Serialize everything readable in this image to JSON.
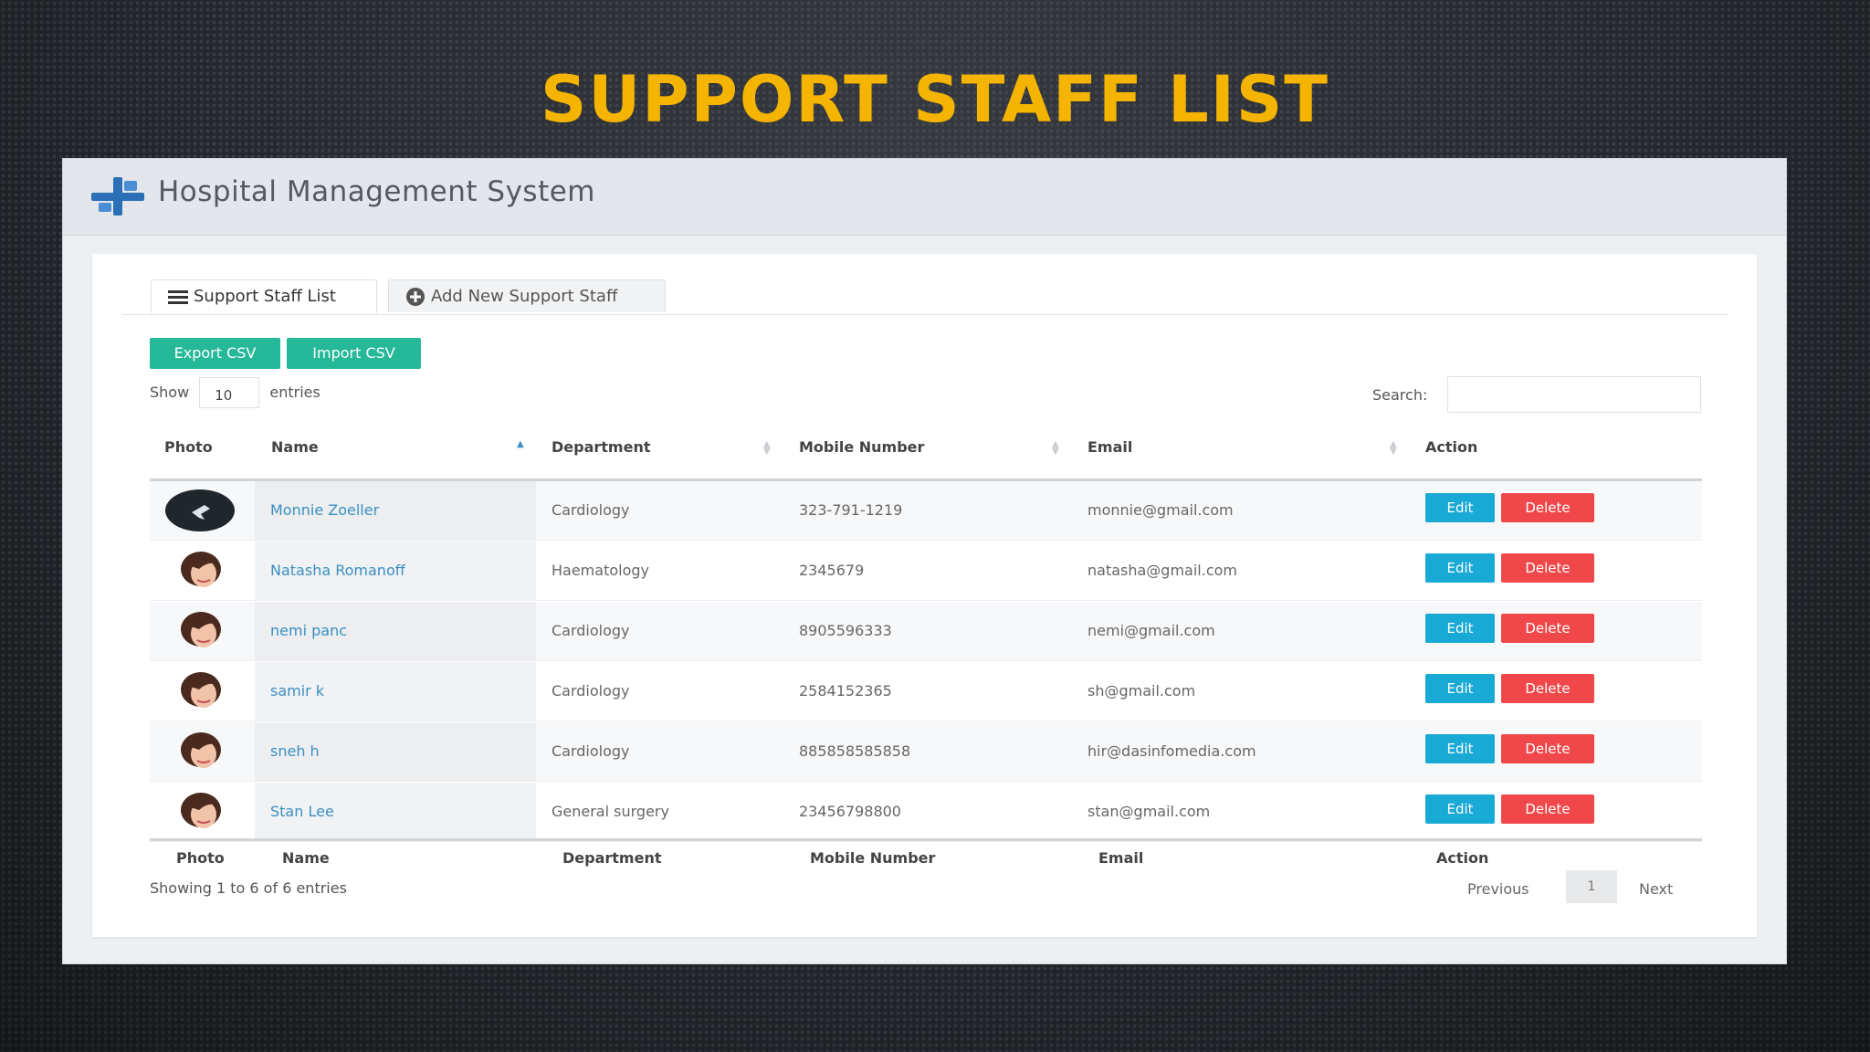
{
  "slide_title": "SUPPORT STAFF LIST",
  "app": {
    "name": "Hospital Management System"
  },
  "tabs": [
    {
      "label": "Support Staff List",
      "icon": "list-icon",
      "active": true
    },
    {
      "label": "Add New Support Staff",
      "icon": "plus-circle-icon",
      "active": false
    }
  ],
  "toolbar": {
    "export_label": "Export CSV",
    "import_label": "Import CSV"
  },
  "length": {
    "show_label": "Show",
    "value": "10",
    "entries_label": "entries"
  },
  "search": {
    "label": "Search:",
    "value": ""
  },
  "columns": [
    "Photo",
    "Name",
    "Department",
    "Mobile Number",
    "Email",
    "Action"
  ],
  "rows": [
    {
      "name": "Monnie Zoeller",
      "department": "Cardiology",
      "mobile": "323-791-1219",
      "email": "monnie@gmail.com",
      "photo": "dark-avatar"
    },
    {
      "name": "Natasha Romanoff",
      "department": "Haematology",
      "mobile": "2345679",
      "email": "natasha@gmail.com",
      "photo": "woman-avatar"
    },
    {
      "name": "nemi panc",
      "department": "Cardiology",
      "mobile": "8905596333",
      "email": "nemi@gmail.com",
      "photo": "woman-avatar"
    },
    {
      "name": "samir k",
      "department": "Cardiology",
      "mobile": "2584152365",
      "email": "sh@gmail.com",
      "photo": "woman-avatar"
    },
    {
      "name": "sneh h",
      "department": "Cardiology",
      "mobile": "885858585858",
      "email": "hir@dasinfomedia.com",
      "photo": "woman-avatar"
    },
    {
      "name": "Stan Lee",
      "department": "General surgery",
      "mobile": "23456798800",
      "email": "stan@gmail.com",
      "photo": "woman-avatar"
    }
  ],
  "actions": {
    "edit_label": "Edit",
    "delete_label": "Delete"
  },
  "footer": {
    "info": "Showing 1 to 6 of 6 entries",
    "previous": "Previous",
    "page": "1",
    "next": "Next"
  },
  "colors": {
    "title": "#f4b400",
    "teal_button": "#25b99a",
    "edit_button": "#19a9d5",
    "delete_button": "#f0484a",
    "link": "#3a8fc2"
  }
}
